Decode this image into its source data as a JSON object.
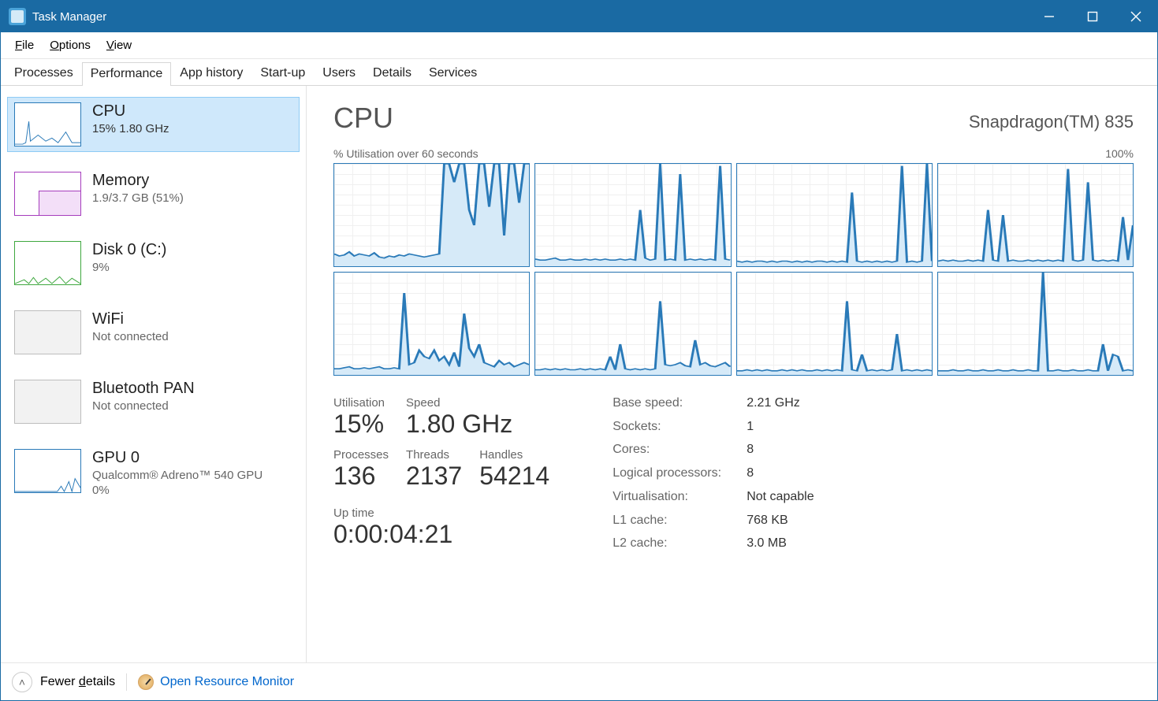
{
  "window": {
    "title": "Task Manager"
  },
  "menu": {
    "file": "File",
    "options": "Options",
    "view": "View"
  },
  "tabs": [
    "Processes",
    "Performance",
    "App history",
    "Start-up",
    "Users",
    "Details",
    "Services"
  ],
  "activeTab": 1,
  "sidebar": {
    "items": [
      {
        "name": "CPU",
        "sub": "15%  1.80 GHz"
      },
      {
        "name": "Memory",
        "sub": "1.9/3.7 GB (51%)"
      },
      {
        "name": "Disk 0 (C:)",
        "sub": "9%"
      },
      {
        "name": "WiFi",
        "sub": "Not connected"
      },
      {
        "name": "Bluetooth PAN",
        "sub": "Not connected"
      },
      {
        "name": "GPU 0",
        "sub": "Qualcomm® Adreno™ 540 GPU",
        "sub2": "0%"
      }
    ]
  },
  "main": {
    "title": "CPU",
    "model": "Snapdragon(TM) 835",
    "chartCaptionLeft": "% Utilisation over 60 seconds",
    "chartCaptionRight": "100%",
    "stats": {
      "utilisationLabel": "Utilisation",
      "utilisation": "15%",
      "speedLabel": "Speed",
      "speed": "1.80 GHz",
      "processesLabel": "Processes",
      "processes": "136",
      "threadsLabel": "Threads",
      "threads": "2137",
      "handlesLabel": "Handles",
      "handles": "54214",
      "uptimeLabel": "Up time",
      "uptime": "0:00:04:21"
    },
    "specs": [
      {
        "label": "Base speed:",
        "value": "2.21 GHz"
      },
      {
        "label": "Sockets:",
        "value": "1"
      },
      {
        "label": "Cores:",
        "value": "8"
      },
      {
        "label": "Logical processors:",
        "value": "8"
      },
      {
        "label": "Virtualisation:",
        "value": "Not capable"
      },
      {
        "label": "L1 cache:",
        "value": "768 KB"
      },
      {
        "label": "L2 cache:",
        "value": "3.0 MB"
      }
    ]
  },
  "footer": {
    "fewerDetails": "Fewer details",
    "openResourceMonitor": "Open Resource Monitor"
  },
  "chart_data": {
    "type": "line",
    "title": "% Utilisation over 60 seconds",
    "xlabel": "",
    "ylabel": "",
    "ylim": [
      0,
      100
    ],
    "series": [
      {
        "name": "Core 0",
        "values": [
          12,
          10,
          11,
          14,
          10,
          12,
          11,
          10,
          13,
          9,
          8,
          10,
          9,
          11,
          10,
          12,
          11,
          10,
          9,
          10,
          11,
          12,
          100,
          100,
          82,
          100,
          100,
          55,
          40,
          100,
          100,
          58,
          100,
          100,
          30,
          100,
          100,
          62,
          100,
          100
        ]
      },
      {
        "name": "Core 1",
        "values": [
          7,
          6,
          6,
          7,
          8,
          6,
          6,
          7,
          6,
          6,
          7,
          6,
          7,
          6,
          7,
          6,
          6,
          7,
          6,
          7,
          6,
          55,
          8,
          6,
          7,
          100,
          6,
          7,
          6,
          90,
          6,
          7,
          6,
          7,
          6,
          7,
          6,
          98,
          7,
          6
        ]
      },
      {
        "name": "Core 2",
        "values": [
          5,
          4,
          5,
          4,
          5,
          5,
          4,
          5,
          4,
          5,
          5,
          4,
          5,
          4,
          5,
          4,
          5,
          5,
          4,
          5,
          4,
          5,
          4,
          72,
          5,
          4,
          5,
          4,
          5,
          4,
          5,
          4,
          5,
          98,
          4,
          5,
          4,
          5,
          100,
          5
        ]
      },
      {
        "name": "Core 3",
        "values": [
          5,
          6,
          5,
          6,
          5,
          5,
          6,
          5,
          6,
          5,
          55,
          6,
          5,
          50,
          5,
          6,
          5,
          5,
          6,
          5,
          6,
          5,
          6,
          5,
          6,
          5,
          95,
          6,
          5,
          6,
          82,
          6,
          5,
          6,
          5,
          6,
          5,
          48,
          6,
          40
        ]
      },
      {
        "name": "Core 4",
        "values": [
          6,
          6,
          7,
          8,
          6,
          6,
          7,
          6,
          7,
          8,
          6,
          6,
          7,
          6,
          80,
          10,
          12,
          24,
          18,
          16,
          24,
          14,
          18,
          10,
          22,
          8,
          60,
          26,
          18,
          30,
          12,
          10,
          8,
          14,
          10,
          12,
          8,
          10,
          12,
          10
        ]
      },
      {
        "name": "Core 5",
        "values": [
          5,
          5,
          6,
          5,
          6,
          5,
          6,
          5,
          5,
          6,
          5,
          6,
          5,
          6,
          5,
          18,
          5,
          30,
          6,
          5,
          6,
          5,
          6,
          5,
          6,
          72,
          10,
          9,
          10,
          12,
          9,
          8,
          34,
          10,
          12,
          9,
          8,
          10,
          12,
          8
        ]
      },
      {
        "name": "Core 6",
        "values": [
          4,
          4,
          5,
          4,
          5,
          4,
          5,
          4,
          4,
          5,
          4,
          5,
          4,
          5,
          4,
          4,
          5,
          4,
          5,
          4,
          5,
          4,
          72,
          5,
          4,
          20,
          4,
          5,
          4,
          5,
          4,
          5,
          40,
          4,
          5,
          4,
          5,
          4,
          5,
          4
        ]
      },
      {
        "name": "Core 7",
        "values": [
          4,
          4,
          4,
          5,
          4,
          4,
          5,
          4,
          4,
          5,
          4,
          4,
          5,
          4,
          4,
          5,
          4,
          4,
          5,
          4,
          4,
          100,
          4,
          4,
          5,
          4,
          4,
          5,
          4,
          4,
          5,
          4,
          4,
          30,
          4,
          20,
          18,
          4,
          5,
          4
        ]
      }
    ]
  }
}
